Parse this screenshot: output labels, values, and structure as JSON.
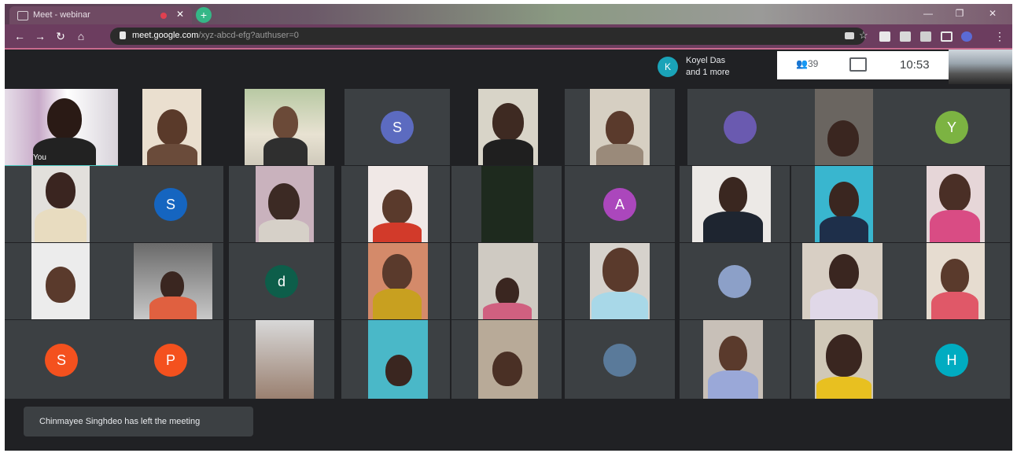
{
  "browser": {
    "tab_title": "Meet - webinar",
    "url_domain": "meet.google.com",
    "url_path": "/xyz-abcd-efg?authuser=0",
    "window_controls": [
      "—",
      "❐",
      "✕"
    ]
  },
  "meet": {
    "participants_first": "Koyel Das",
    "participants_more": "and 1 more",
    "participant_avatar_letter": "K",
    "people_count": "39",
    "clock": "10:53",
    "self_label": "You",
    "toast": "Chinmayee Singhdeo has left the meeting"
  },
  "avatars": {
    "r1_s": "S",
    "r1_y": "Y",
    "r2_s": "S",
    "r2_a": "A",
    "r3_d": "d",
    "r4_s": "S",
    "r4_p": "P",
    "r4_h": "H"
  },
  "colors": {
    "accent": "#4ec9c2",
    "chrome_tab": "#6f4a63",
    "address_bar": "#6c3d5f",
    "meet_bg": "#202124",
    "tile_bg": "#3c4043"
  }
}
